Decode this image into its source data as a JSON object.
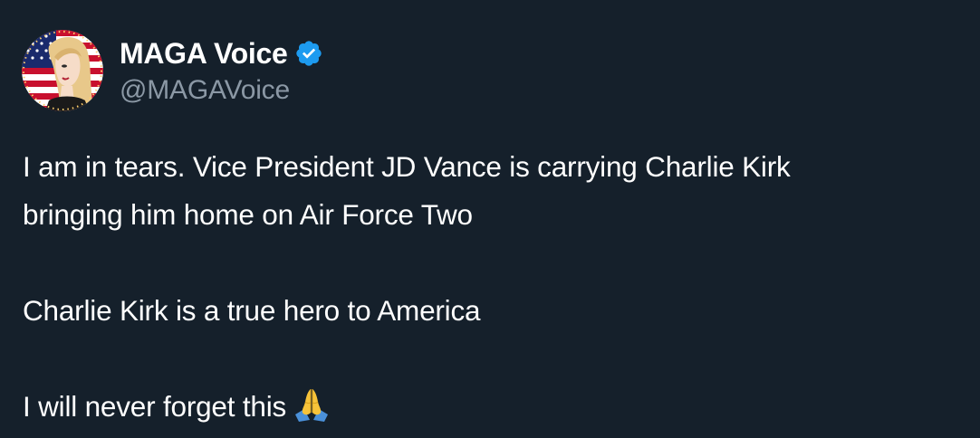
{
  "account": {
    "display_name": "MAGA Voice",
    "handle": "@MAGAVoice",
    "verified": true,
    "verified_color": "#1d9bf0"
  },
  "tweet": {
    "paragraph_1_line_1": "I am in tears. Vice President JD Vance is carrying Charlie Kirk",
    "paragraph_1_line_2": "bringing him home on Air Force Two",
    "paragraph_2": "Charlie Kirk is a true hero to America",
    "paragraph_3": "I will never forget this",
    "emoji": "folded-hands-emoji"
  },
  "colors": {
    "background": "#15202b",
    "primary_text": "#ffffff",
    "secondary_text": "#8b98a5"
  }
}
